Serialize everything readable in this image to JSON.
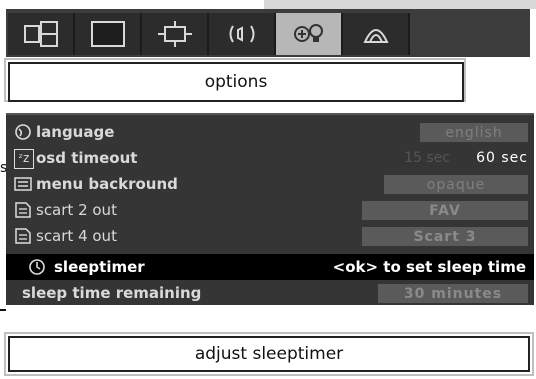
{
  "title": "options",
  "tabs": [
    {
      "icon": "picture-layout-icon",
      "active": false
    },
    {
      "icon": "screen-icon",
      "active": false
    },
    {
      "icon": "zoom-frame-icon",
      "active": false
    },
    {
      "icon": "audio-icon",
      "active": false
    },
    {
      "icon": "options-bulb-icon",
      "active": true
    },
    {
      "icon": "channel-stack-icon",
      "active": false
    }
  ],
  "menu": {
    "rows": [
      {
        "icon": "globe-icon",
        "label": "language",
        "value": "english"
      },
      {
        "icon": "osd-icon",
        "icon_text": "ᶻz",
        "label": "osd timeout",
        "value_prefix": "15 sec",
        "value": "60 sec"
      },
      {
        "icon": "menu-bg-icon",
        "label": "menu backround",
        "value": "opaque"
      },
      {
        "icon": "scart-icon",
        "label": "scart 2 out",
        "value": "FAV"
      },
      {
        "icon": "scart-icon",
        "label": "scart 4 out",
        "value": "Scart 3"
      },
      {
        "icon": "clock-icon",
        "label": "sleeptimer",
        "hint": "<ok> to set sleep time",
        "selected": true
      },
      {
        "label": "sleep time remaining",
        "value": "30 minutes"
      }
    ]
  },
  "footer": {
    "help": "adjust sleeptimer"
  },
  "side_fragment": "s"
}
